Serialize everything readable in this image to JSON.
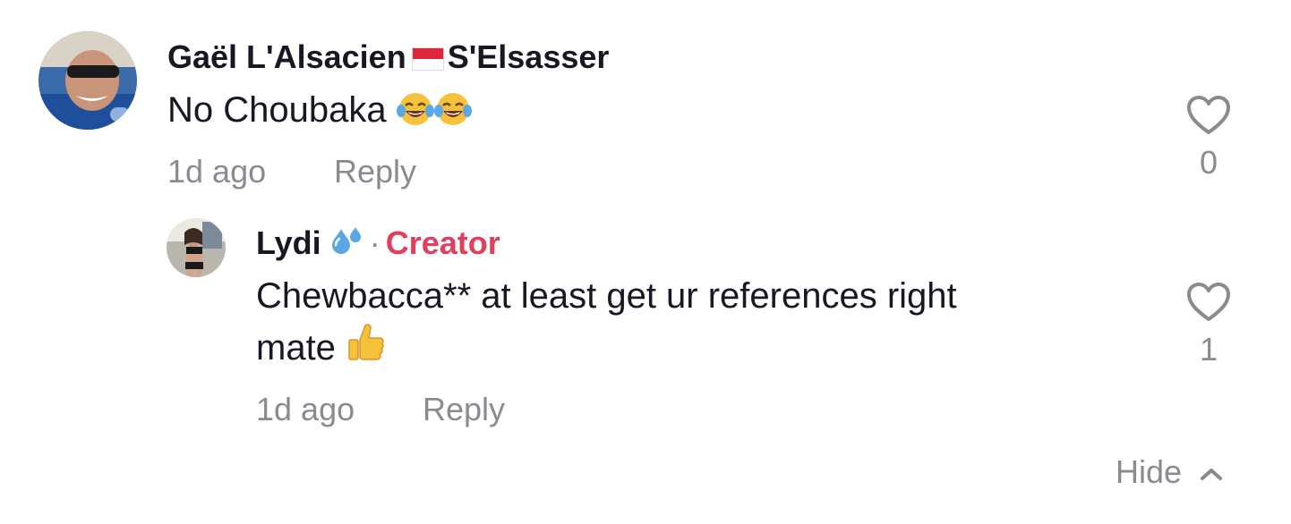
{
  "comment": {
    "username_part1": "Gaël L'Alsacien",
    "username_part2": "S'Elsasser",
    "flag_icon": "flag-red-white-icon",
    "text": "No Choubaka",
    "emoji": "face-with-tears-of-joy-icon x2",
    "timestamp": "1d ago",
    "reply_label": "Reply",
    "like_count": "0"
  },
  "reply": {
    "username": "Lydi",
    "username_emoji": "sweat-droplets-icon",
    "separator": "·",
    "creator_label": "Creator",
    "creator_color": "#e33e5c",
    "text_line1": "Chewbacca** at least get ur references right",
    "text_line2": "mate",
    "emoji": "thumbs-up-icon",
    "timestamp": "1d ago",
    "reply_label": "Reply",
    "like_count": "1"
  },
  "thread": {
    "hide_label": "Hide",
    "hide_icon": "chevron-up-icon"
  },
  "colors": {
    "text_primary": "#161823",
    "text_secondary": "#8a8b91",
    "accent_creator": "#e33e5c"
  }
}
